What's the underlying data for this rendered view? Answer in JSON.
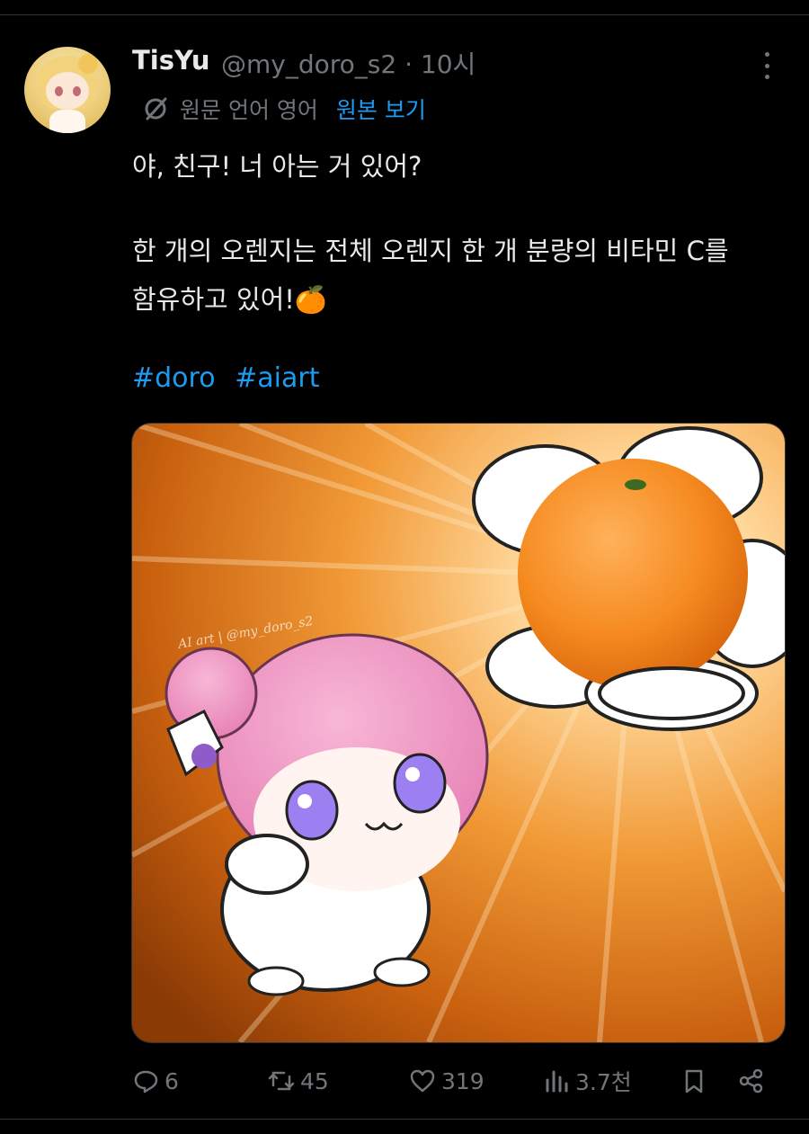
{
  "tweet": {
    "display_name": "TisYu",
    "handle_time": "@my_doro_s2 · 10시",
    "translate": {
      "source_label": "원문 언어 영어",
      "view_original": "원본 보기"
    },
    "text_line1": "야, 친구! 너 아는 거 있어?",
    "text_line2": "한 개의 오렌지는 전체 오렌지 한 개 분량의 비타민 C를",
    "text_line3": "함유하고 있어!🍊",
    "hashtags": [
      "#doro",
      "#aiart"
    ],
    "image_watermark": "AI art | @my_doro_s2"
  },
  "actions": {
    "reply_count": "6",
    "retweet_count": "45",
    "like_count": "319",
    "views_count": "3.7천"
  },
  "icons": {
    "more": "more-vertical-icon",
    "translate": "translate-icon",
    "reply": "reply-icon",
    "retweet": "retweet-icon",
    "like": "heart-icon",
    "views": "views-icon",
    "bookmark": "bookmark-icon",
    "share": "share-icon"
  },
  "colors": {
    "background": "#000000",
    "text": "#e7e9ea",
    "muted": "#71767b",
    "link": "#1d9bf0"
  }
}
